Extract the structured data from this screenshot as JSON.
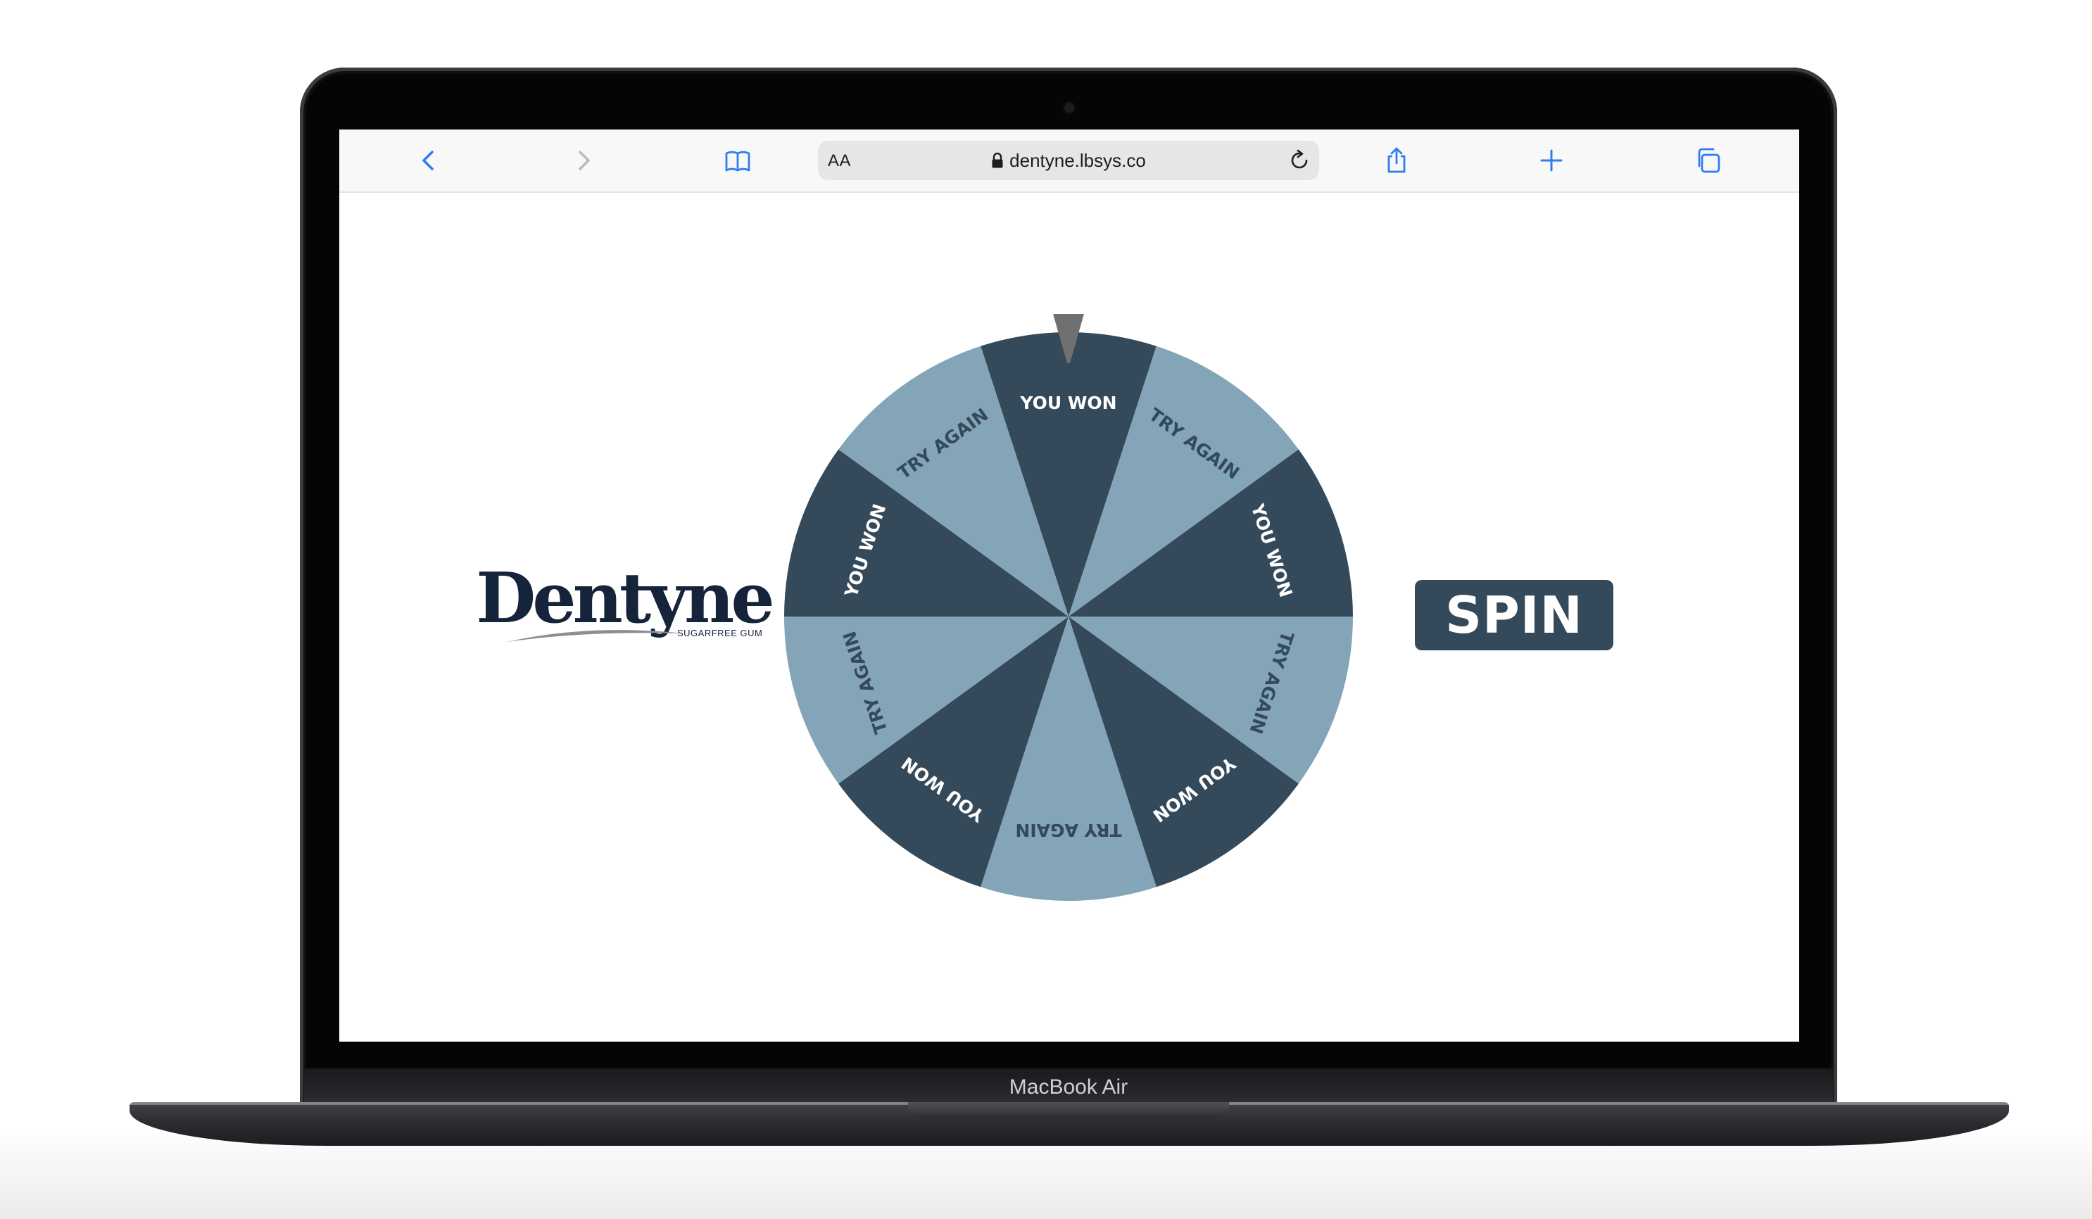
{
  "device": {
    "label": "MacBook Air"
  },
  "browser": {
    "reader_label": "AA",
    "url": "dentyne.lbsys.co",
    "icons": {
      "back": "chevron-left-icon",
      "forward": "chevron-right-icon",
      "bookmarks": "book-icon",
      "secure": "lock-icon",
      "reload": "reload-icon",
      "share": "share-icon",
      "new_tab": "plus-icon",
      "tabs": "tabs-icon"
    }
  },
  "page": {
    "logo": {
      "word": "Dentyne",
      "tagline": "SUGARFREE GUM"
    },
    "wheel": {
      "colors": {
        "dark": "#34495a",
        "light": "#84a5b8",
        "dark_text": "#ffffff",
        "light_text": "#34495a",
        "pointer": "#707070"
      },
      "segments": [
        {
          "label": "YOU WON",
          "tone": "dark"
        },
        {
          "label": "TRY AGAIN",
          "tone": "light"
        },
        {
          "label": "YOU WON",
          "tone": "dark"
        },
        {
          "label": "TRY AGAIN",
          "tone": "light"
        },
        {
          "label": "YOU WON",
          "tone": "dark"
        },
        {
          "label": "TRY AGAIN",
          "tone": "light"
        },
        {
          "label": "YOU WON",
          "tone": "dark"
        },
        {
          "label": "TRY AGAIN",
          "tone": "light"
        },
        {
          "label": "YOU WON",
          "tone": "dark"
        },
        {
          "label": "TRY AGAIN",
          "tone": "light"
        }
      ]
    },
    "spin_button": {
      "label": "SPIN"
    }
  }
}
